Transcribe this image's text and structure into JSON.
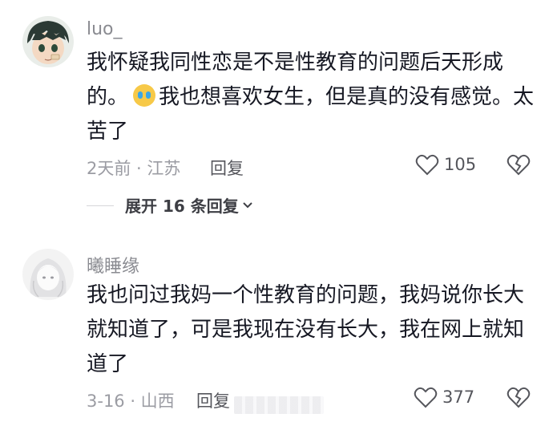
{
  "comments": [
    {
      "username": "luo_",
      "text_part1": "我怀疑我同性恋是不是性教育的问题后天形成的。",
      "text_part2": "我也想喜欢女生，但是真的没有感觉。太苦了",
      "meta": "2天前 · 江苏",
      "reply_label": "回复",
      "likes": "105",
      "expand_label": "展开 16 条回复"
    },
    {
      "username": "曦睡缘",
      "text": "我也问过我妈一个性教育的问题，我妈说你长大就知道了，可是我现在没有长大，我在网上就知道了",
      "meta": "3-16 · 山西",
      "reply_label": "回复",
      "likes": "377"
    }
  ],
  "icons": {
    "emoji": "crying-emoji",
    "like": "heart-outline-icon",
    "dislike": "broken-heart-icon",
    "expand": "chevron-down-icon"
  },
  "colors": {
    "text": "#161823",
    "secondary": "#8a8b91",
    "emoji_face": "#f7c948",
    "tears": "#3aa6e8"
  }
}
